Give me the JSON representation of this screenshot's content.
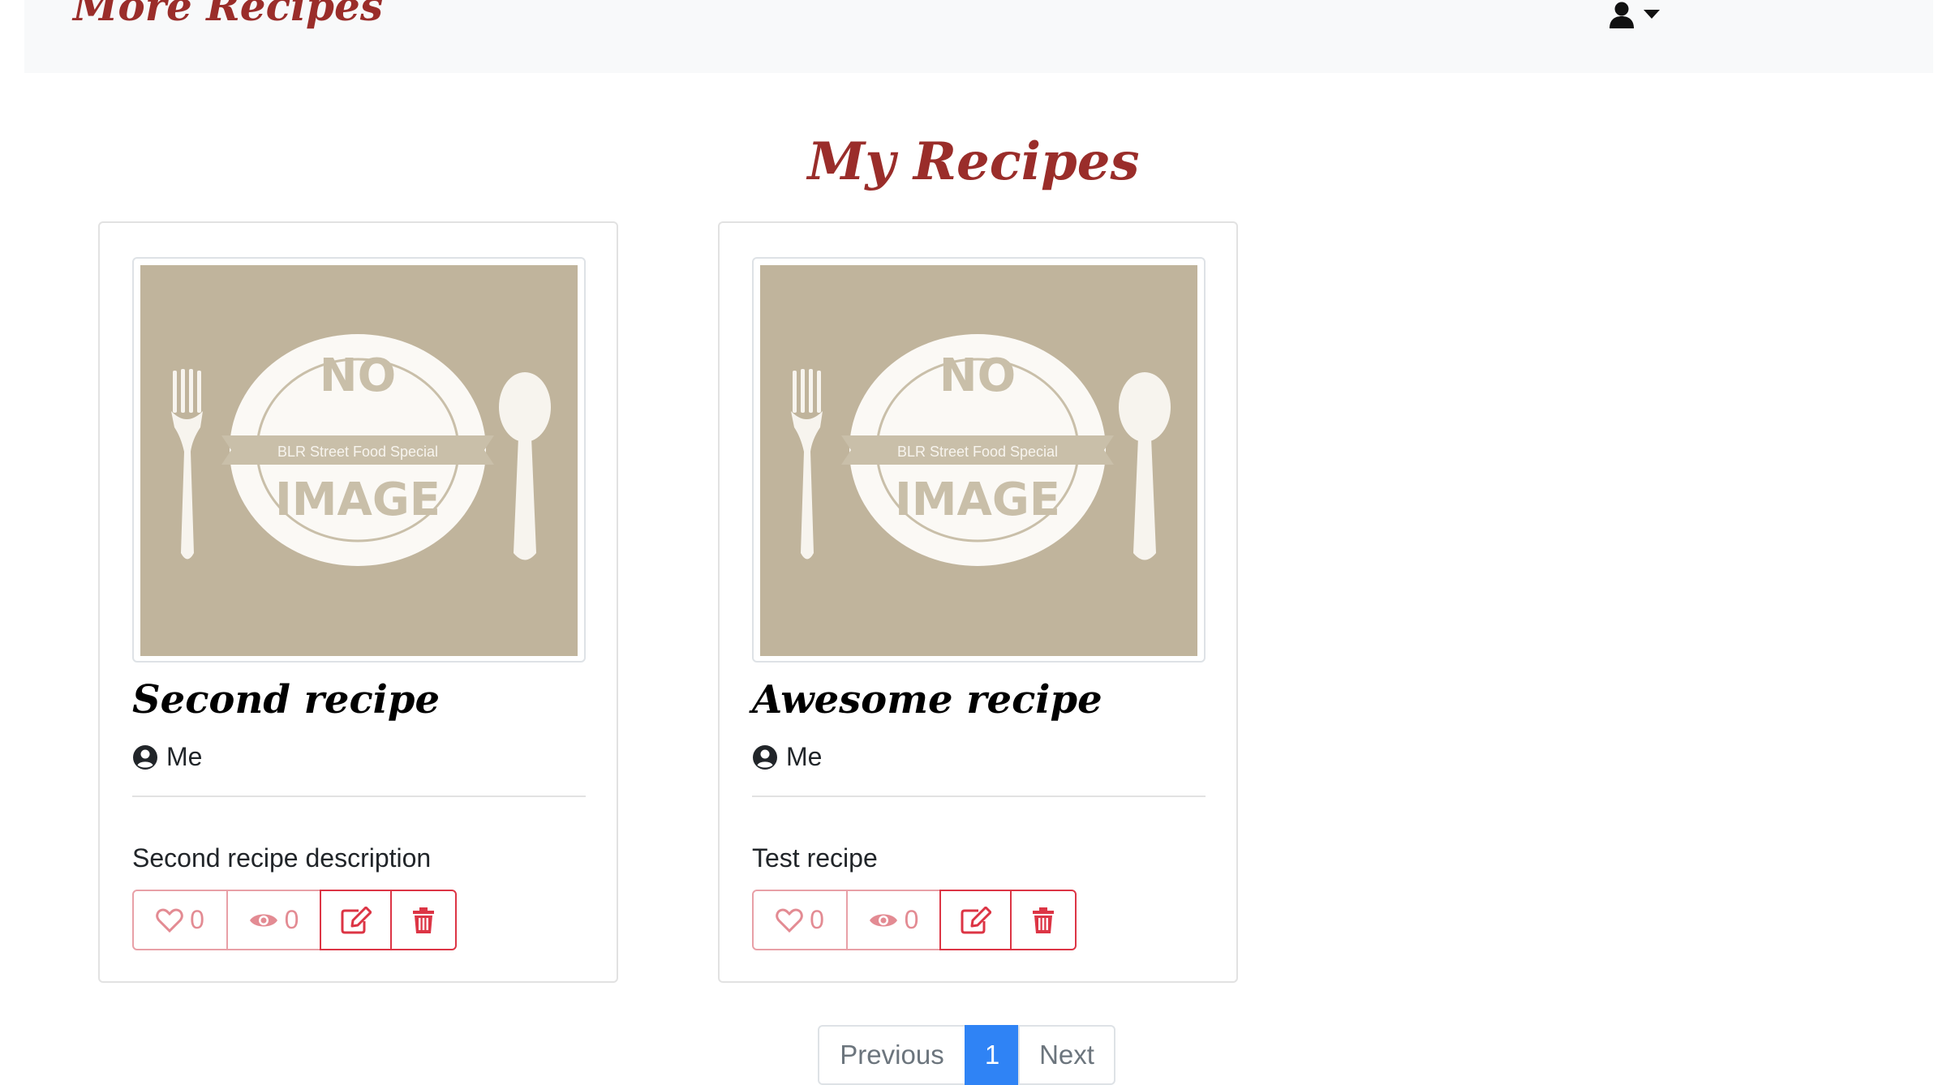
{
  "navbar": {
    "brand": "More Recipes",
    "user_menu_icon": "user-icon",
    "caret_icon": "caret-down-icon"
  },
  "page": {
    "title": "My Recipes"
  },
  "recipes": [
    {
      "title": "Second recipe",
      "author": "Me",
      "description": "Second recipe description",
      "image_text_top": "NO",
      "image_text_band": "BLR Street Food Special",
      "image_text_bottom": "IMAGE",
      "likes": "0",
      "views": "0"
    },
    {
      "title": "Awesome recipe",
      "author": "Me",
      "description": "Test recipe",
      "image_text_top": "NO",
      "image_text_band": "BLR Street Food Special",
      "image_text_bottom": "IMAGE",
      "likes": "0",
      "views": "0"
    }
  ],
  "pagination": {
    "previous": "Previous",
    "current": "1",
    "next": "Next"
  },
  "colors": {
    "brand": "#9a2d2a",
    "danger": "#dc3545",
    "active_page": "#2f83f5",
    "placeholder_bg": "#c0b49c"
  }
}
